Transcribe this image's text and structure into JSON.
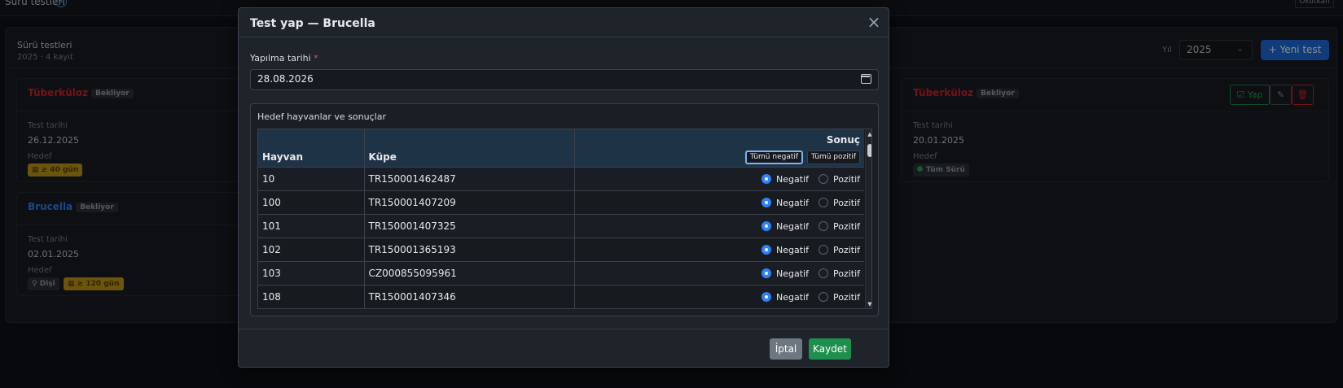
{
  "background": {
    "top_title": "Sürü testleri",
    "top_right_button": "Okutkan",
    "section_title": "Sürü testleri",
    "section_subtitle": "2025 · 4 kayıt",
    "year_label": "Yıl",
    "year_value": "2025",
    "new_test_button": "+ Yeni test",
    "cards": [
      {
        "name": "Tüberküloz",
        "status": "Bekliyor",
        "date_label": "Test tarihi",
        "date": "26.12.2025",
        "target_label": "Hedef",
        "targets": [
          "≥ 40 gün"
        ],
        "name_color": "#d1242f"
      },
      {
        "name": "Brucella",
        "status": "Bekliyor",
        "date_label": "Test tarihi",
        "date": "02.01.2025",
        "target_label": "Hedef",
        "targets": [
          "Dişi",
          "≥ 120 gün"
        ],
        "name_color": "#2f81f7"
      },
      {
        "name": "Tüberküloz",
        "status": "Bekliyor",
        "date_label": "Test tarihi",
        "date": "20.01.2025",
        "target_label": "Hedef",
        "targets": [
          "Tüm Sürü"
        ],
        "name_color": "#d1242f",
        "actions": [
          "Yap"
        ]
      }
    ]
  },
  "modal": {
    "title": "Test yap — Brucella",
    "date_label": "Yapılma tarihi",
    "date_required": "*",
    "date_value": "28.08.2026",
    "group_title": "Hedef hayvanlar ve sonuçlar",
    "columns": {
      "animal": "Hayvan",
      "tag": "Küpe",
      "result": "Sonuç"
    },
    "all_negative_button": "Tümü negatif",
    "all_positive_button": "Tümü pozitif",
    "option_negative": "Negatif",
    "option_positive": "Pozitif",
    "rows": [
      {
        "animal": "10",
        "tag": "TR150001462487",
        "result": "Negatif"
      },
      {
        "animal": "100",
        "tag": "TR150001407209",
        "result": "Negatif"
      },
      {
        "animal": "101",
        "tag": "TR150001407325",
        "result": "Negatif"
      },
      {
        "animal": "102",
        "tag": "TR150001365193",
        "result": "Negatif"
      },
      {
        "animal": "103",
        "tag": "CZ000855095961",
        "result": "Negatif"
      },
      {
        "animal": "108",
        "tag": "TR150001407346",
        "result": "Negatif"
      }
    ],
    "cancel_button": "İptal",
    "save_button": "Kaydet"
  }
}
